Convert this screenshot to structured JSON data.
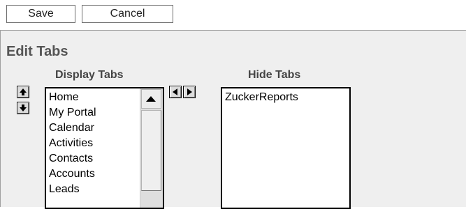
{
  "toolbar": {
    "save_label": "Save",
    "cancel_label": "Cancel"
  },
  "panel": {
    "title": "Edit Tabs",
    "display_heading": "Display Tabs",
    "hide_heading": "Hide Tabs"
  },
  "display_tabs": [
    "Home",
    "My Portal",
    "Calendar",
    "Activities",
    "Contacts",
    "Accounts",
    "Leads"
  ],
  "hide_tabs": [
    "ZuckerReports"
  ],
  "icons": {
    "move_up": "arrow-up-icon",
    "move_down": "arrow-down-icon",
    "move_left": "arrow-left-icon",
    "move_right": "arrow-right-icon",
    "scroll_up": "scroll-up-arrow-icon"
  }
}
